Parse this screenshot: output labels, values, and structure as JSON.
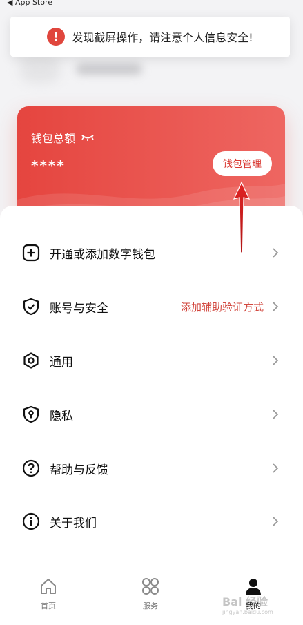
{
  "status_bar": {
    "back_label": "◀ App Store"
  },
  "toast": {
    "message": "发现截屏操作，请注意个人信息安全!"
  },
  "wallet": {
    "title": "钱包总额",
    "amount": "****",
    "manage_button": "钱包管理"
  },
  "menu": {
    "items": [
      {
        "label": "开通或添加数字钱包",
        "icon": "plus-square-icon",
        "extra": ""
      },
      {
        "label": "账号与安全",
        "icon": "shield-check-icon",
        "extra": "添加辅助验证方式"
      },
      {
        "label": "通用",
        "icon": "hexagon-gear-icon",
        "extra": ""
      },
      {
        "label": "隐私",
        "icon": "privacy-shield-icon",
        "extra": ""
      },
      {
        "label": "帮助与反馈",
        "icon": "help-circle-icon",
        "extra": ""
      },
      {
        "label": "关于我们",
        "icon": "info-circle-icon",
        "extra": ""
      }
    ]
  },
  "tabbar": {
    "tabs": [
      {
        "label": "首页",
        "icon": "home-icon"
      },
      {
        "label": "服务",
        "icon": "grid-icon"
      },
      {
        "label": "我的",
        "icon": "user-icon",
        "active": true
      }
    ]
  },
  "watermark": {
    "logo": "Bai 经验",
    "url": "jingyan.baidu.com"
  },
  "colors": {
    "accent": "#e5453f",
    "accent_text": "#d2483f"
  }
}
